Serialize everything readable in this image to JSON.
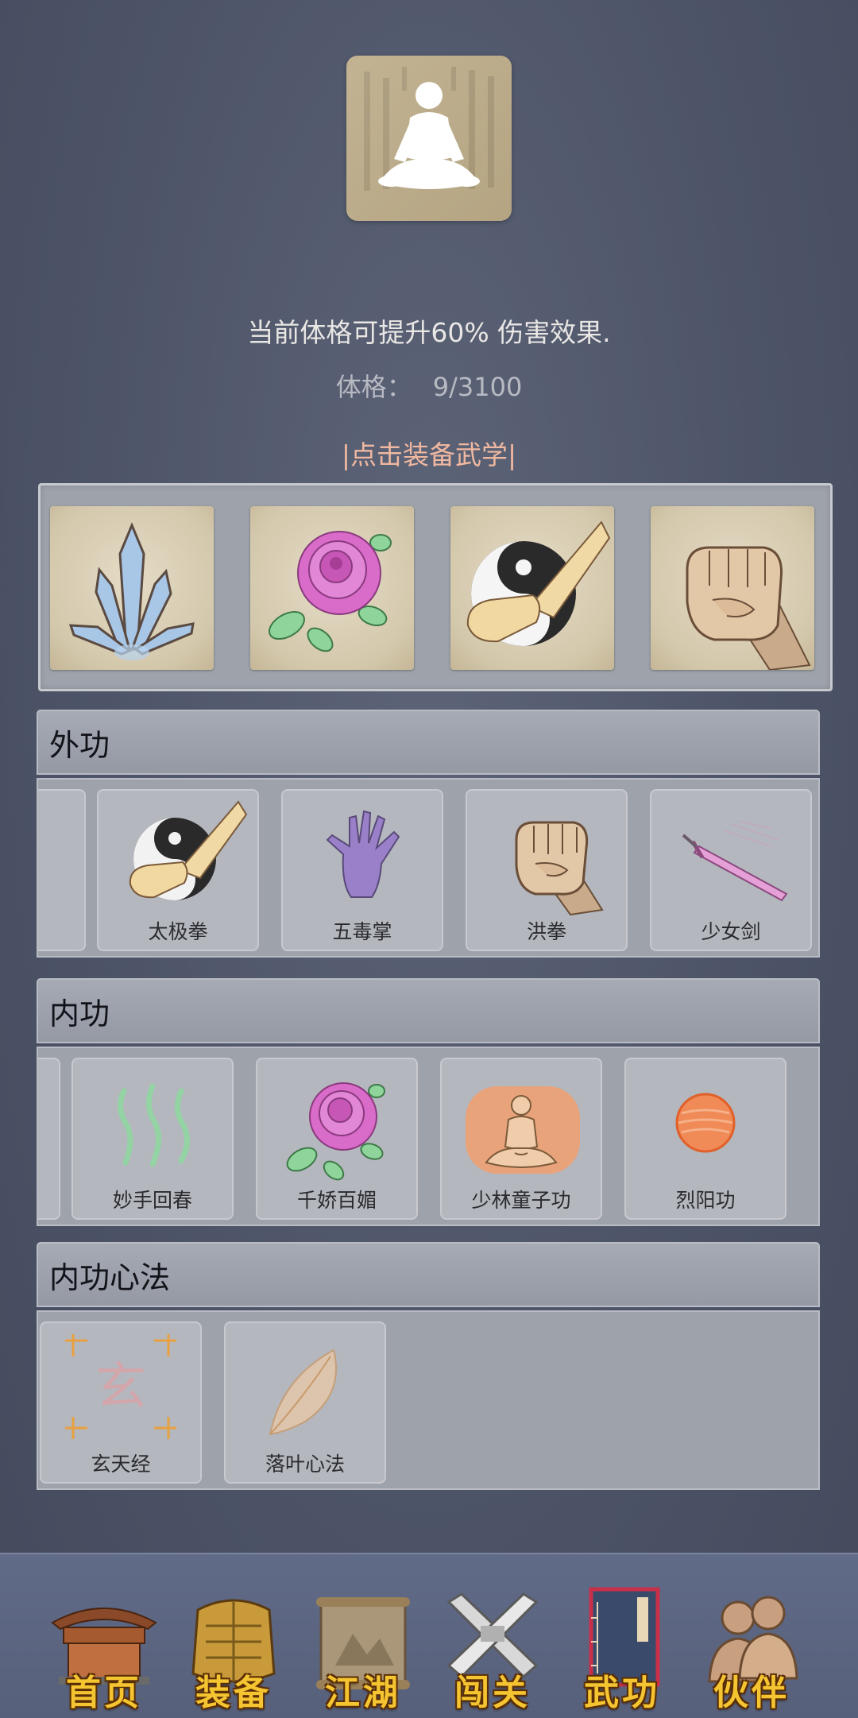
{
  "profile": {
    "description": "当前体格可提升60% 伤害效果.",
    "stat_label": "体格：",
    "stat_value": "9/3100",
    "equip_link": "|点击装备武学|"
  },
  "equipped": [
    {
      "icon": "crystal-blades-icon"
    },
    {
      "icon": "rose-icon"
    },
    {
      "icon": "taiji-fist-icon"
    },
    {
      "icon": "fist-icon"
    }
  ],
  "sections": [
    {
      "title": "外功",
      "items": [
        {
          "name": "",
          "icon": ""
        },
        {
          "name": "太极拳",
          "icon": "taiji-fist-icon"
        },
        {
          "name": "五毒掌",
          "icon": "purple-palm-icon"
        },
        {
          "name": "洪拳",
          "icon": "fist-icon"
        },
        {
          "name": "少女剑",
          "icon": "pink-sword-icon"
        }
      ]
    },
    {
      "title": "内功",
      "items": [
        {
          "name": "",
          "icon": ""
        },
        {
          "name": "妙手回春",
          "icon": "green-wisps-icon"
        },
        {
          "name": "千娇百媚",
          "icon": "rose-icon"
        },
        {
          "name": "少林童子功",
          "icon": "meditating-monk-icon"
        },
        {
          "name": "烈阳功",
          "icon": "sun-orb-icon"
        }
      ]
    },
    {
      "title": "内功心法",
      "items": [
        {
          "name": "玄天经",
          "icon": "xuan-scroll-icon",
          "icon_text": "玄"
        },
        {
          "name": "落叶心法",
          "icon": "leaf-icon"
        }
      ]
    }
  ],
  "nav": [
    {
      "label": "首页",
      "icon": "temple-icon"
    },
    {
      "label": "装备",
      "icon": "armor-icon"
    },
    {
      "label": "江湖",
      "icon": "map-scroll-icon"
    },
    {
      "label": "闯关",
      "icon": "crossed-swords-icon"
    },
    {
      "label": "武功",
      "icon": "book-icon"
    },
    {
      "label": "伙伴",
      "icon": "companions-icon"
    }
  ]
}
